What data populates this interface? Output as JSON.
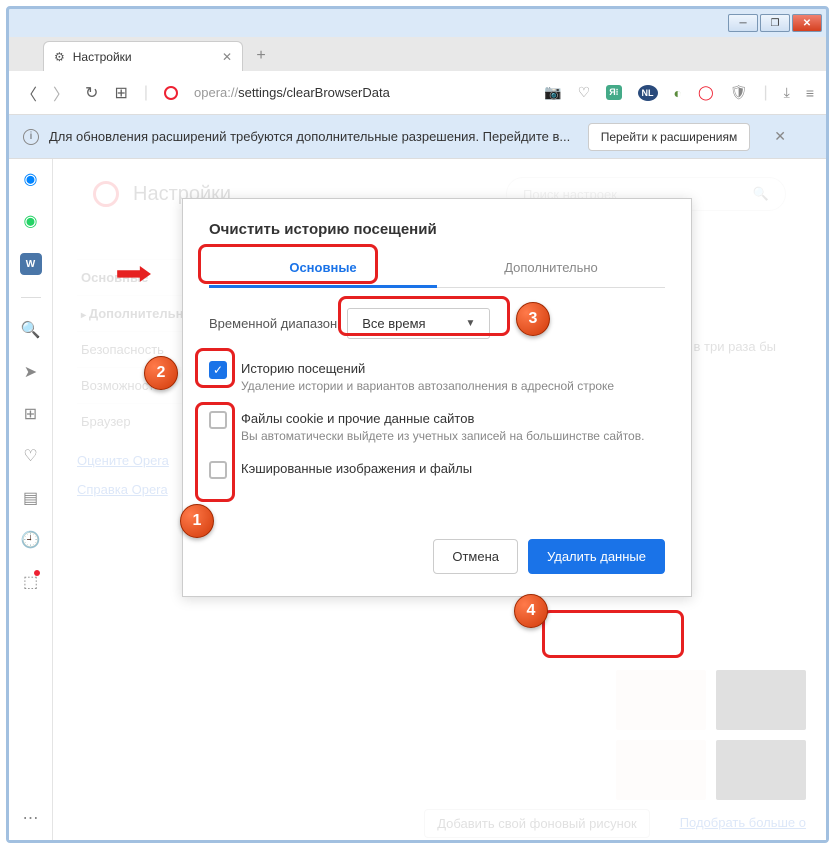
{
  "window": {
    "min": "_",
    "max": "❐",
    "close": "✕"
  },
  "tab": {
    "title": "Настройки"
  },
  "url": {
    "prefix": "opera://",
    "path": "settings/clearBrowserData"
  },
  "notification": {
    "text": "Для обновления расширений требуются дополнительные разрешения. Перейдите в...",
    "button": "Перейти к расширениям"
  },
  "settings": {
    "title": "Настройки",
    "search_placeholder": "Поиск настроек",
    "nav": [
      "Основные",
      "Дополнительные",
      "Безопасность",
      "Возможности",
      "Браузер"
    ],
    "rate": "Оцените Opera",
    "help": "Справка Opera",
    "bg_hint": "е в три раза бы",
    "add_wallpaper": "Добавить свой фоновый рисунок",
    "find_more": "Подобрать больше о"
  },
  "dialog": {
    "title": "Очистить историю посещений",
    "tab_basic": "Основные",
    "tab_advanced": "Дополнительно",
    "range_label": "Временной диапазон",
    "range_value": "Все время",
    "opt1_title": "Историю посещений",
    "opt1_desc": "Удаление истории и вариантов автозаполнения в адресной строке",
    "opt2_title": "Файлы cookie и прочие данные сайтов",
    "opt2_desc": "Вы автоматически выйдете из учетных записей на большинстве сайтов.",
    "opt3_title": "Кэшированные изображения и файлы",
    "cancel": "Отмена",
    "confirm": "Удалить данные"
  },
  "callouts": {
    "c1": "1",
    "c2": "2",
    "c3": "3",
    "c4": "4"
  }
}
